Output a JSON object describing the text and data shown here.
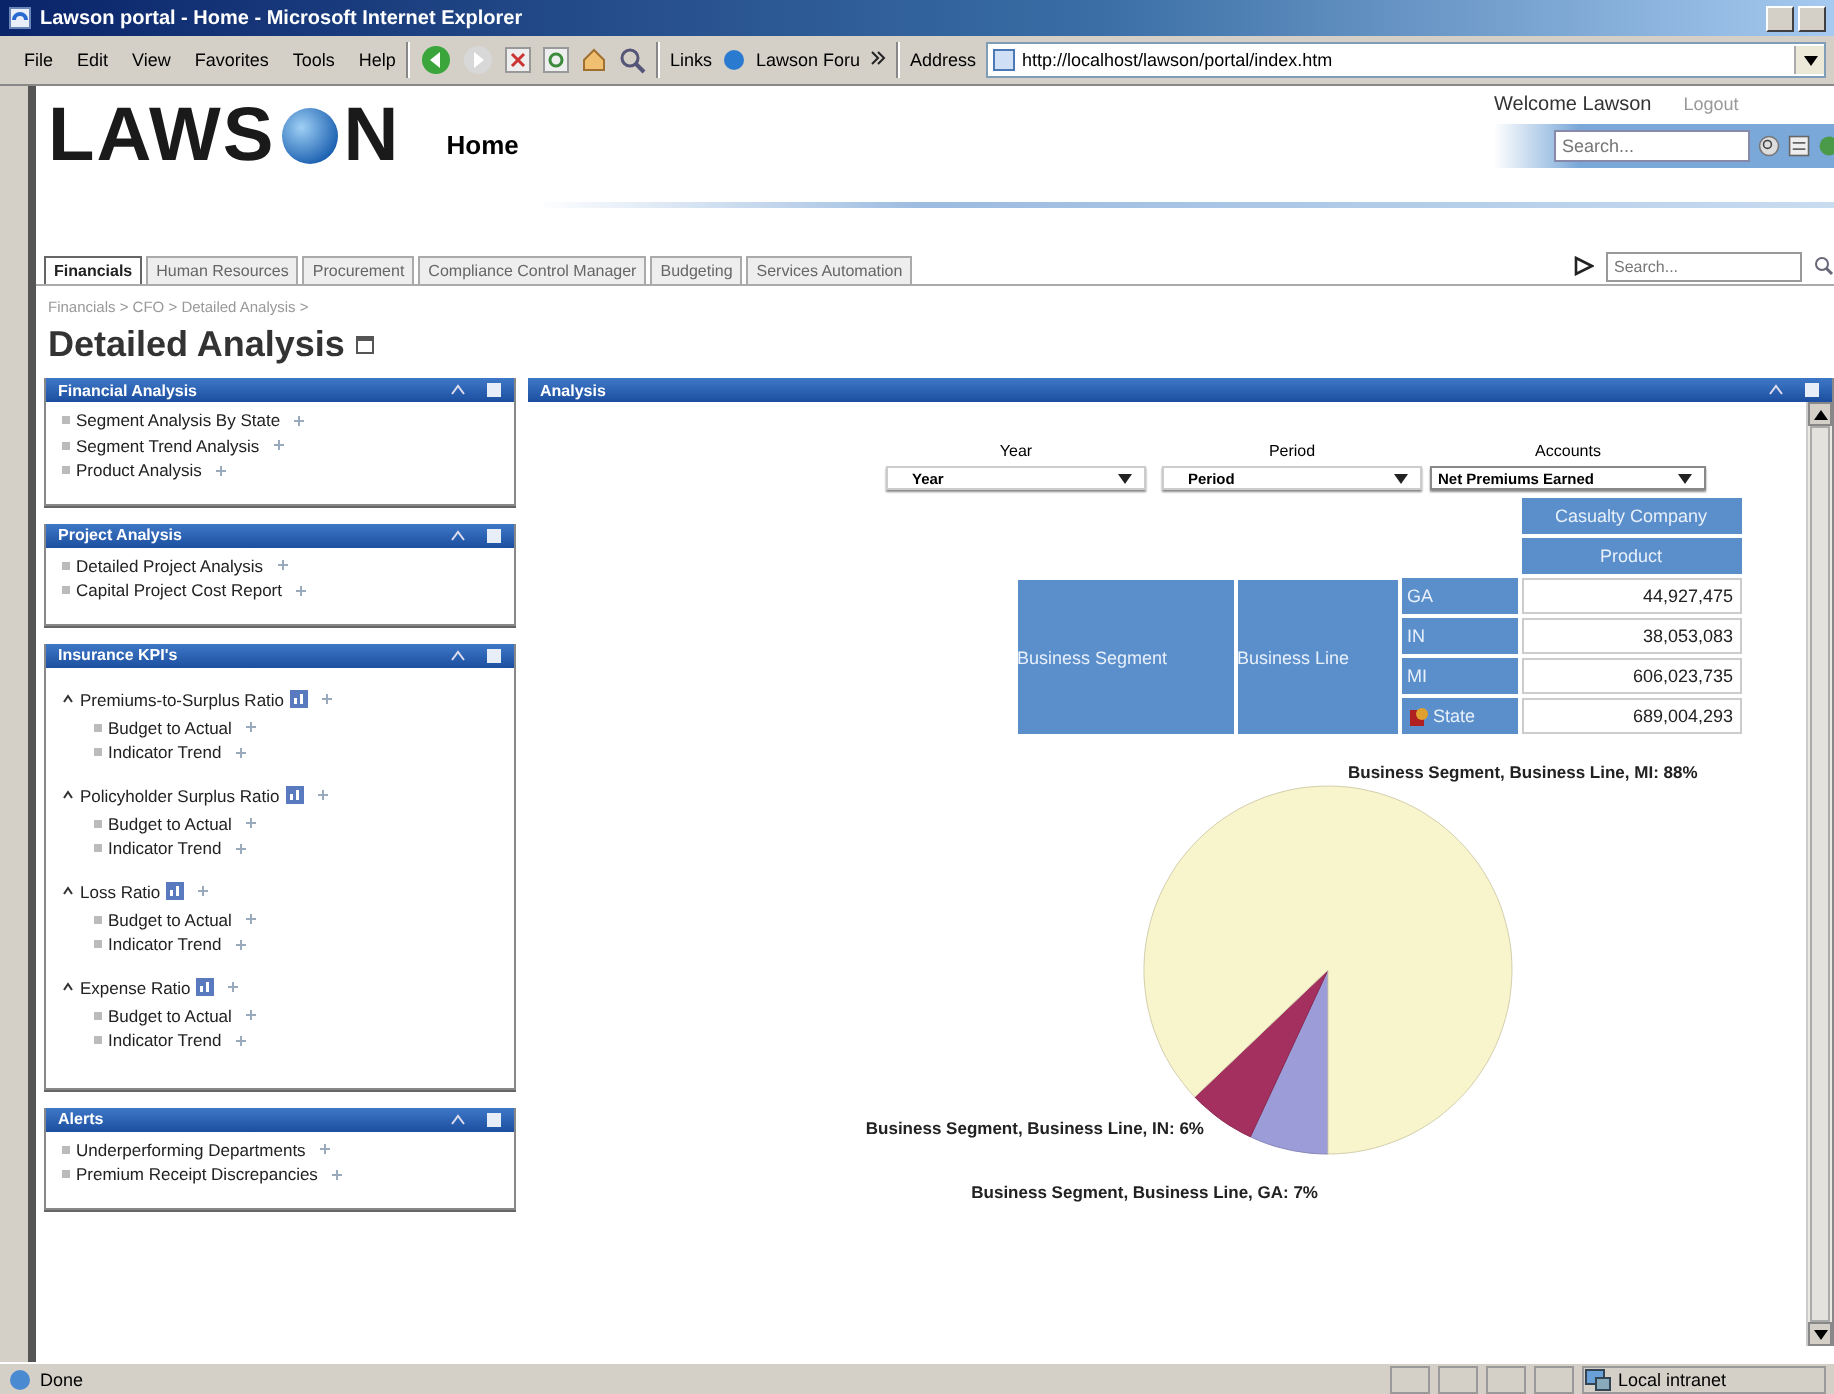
{
  "window": {
    "title": "Lawson portal - Home - Microsoft Internet Explorer"
  },
  "menu": [
    "File",
    "Edit",
    "View",
    "Favorites",
    "Tools",
    "Help"
  ],
  "links": {
    "label": "Links",
    "item": "Lawson Foru"
  },
  "address": {
    "label": "Address",
    "url": "http://localhost/lawson/portal/index.htm"
  },
  "header": {
    "logo_left": "LAWS",
    "logo_right": "N",
    "page": "Home",
    "welcome": "Welcome Lawson",
    "logout": "Logout",
    "search": {
      "placeholder": "Search..."
    }
  },
  "tabs": [
    {
      "label": "Financials",
      "selected": true
    },
    {
      "label": "Human Resources",
      "selected": false
    },
    {
      "label": "Procurement",
      "selected": false
    },
    {
      "label": "Compliance Control Manager",
      "selected": false
    },
    {
      "label": "Budgeting",
      "selected": false
    },
    {
      "label": "Services Automation",
      "selected": false
    }
  ],
  "tab_search": {
    "placeholder": "Search..."
  },
  "breadcrumb": "Financials > CFO > Detailed Analysis >",
  "page_title": "Detailed Analysis",
  "panels": [
    {
      "title": "Financial Analysis",
      "items": [
        {
          "label": "Segment Analysis By State"
        },
        {
          "label": "Segment Trend Analysis"
        },
        {
          "label": "Product Analysis"
        }
      ]
    },
    {
      "title": "Project Analysis",
      "items": [
        {
          "label": "Detailed Project Analysis"
        },
        {
          "label": "Capital Project Cost Report"
        }
      ]
    },
    {
      "title": "Insurance KPI's",
      "items": [
        {
          "label": "Premiums-to-Surplus Ratio",
          "expanded": true,
          "children": [
            {
              "label": "Budget to Actual"
            },
            {
              "label": "Indicator Trend"
            }
          ]
        },
        {
          "label": "Policyholder Surplus Ratio",
          "expanded": true,
          "children": [
            {
              "label": "Budget to Actual"
            },
            {
              "label": "Indicator Trend"
            }
          ]
        },
        {
          "label": "Loss Ratio",
          "expanded": true,
          "children": [
            {
              "label": "Budget to Actual"
            },
            {
              "label": "Indicator Trend"
            }
          ]
        },
        {
          "label": "Expense Ratio",
          "expanded": true,
          "children": [
            {
              "label": "Budget to Actual"
            },
            {
              "label": "Indicator Trend"
            }
          ]
        }
      ]
    },
    {
      "title": "Alerts",
      "items": [
        {
          "label": "Underperforming Departments"
        },
        {
          "label": "Premium Receipt Discrepancies"
        }
      ]
    }
  ],
  "analysis": {
    "title": "Analysis",
    "filters": [
      {
        "label": "Year",
        "value": "Year"
      },
      {
        "label": "Period",
        "value": "Period"
      },
      {
        "label": "Accounts",
        "value": "Net Premiums Earned"
      }
    ],
    "column_headers": [
      "Casualty Company",
      "Product"
    ],
    "row_headers": [
      "Business Segment",
      "Business Line"
    ],
    "rows": [
      {
        "label": "GA",
        "value": "44,927,475",
        "kind": "member"
      },
      {
        "label": "IN",
        "value": "38,053,083",
        "kind": "member"
      },
      {
        "label": "MI",
        "value": "606,023,735",
        "kind": "member"
      },
      {
        "label": "State",
        "value": "689,004,293",
        "kind": "drill"
      }
    ],
    "chart_data": {
      "type": "pie",
      "categories": [
        "Business Segment, Business Line, GA: 7%",
        "Business Segment, Business Line, IN: 6%",
        "Business Segment, Business Line, MI: 88%"
      ],
      "values": [
        7,
        6,
        88
      ],
      "colors": [
        "#9c9cd8",
        "#a3305f",
        "#f8f4cc"
      ]
    }
  },
  "status_bar": {
    "text": "Done",
    "zone": "Local intranet"
  }
}
